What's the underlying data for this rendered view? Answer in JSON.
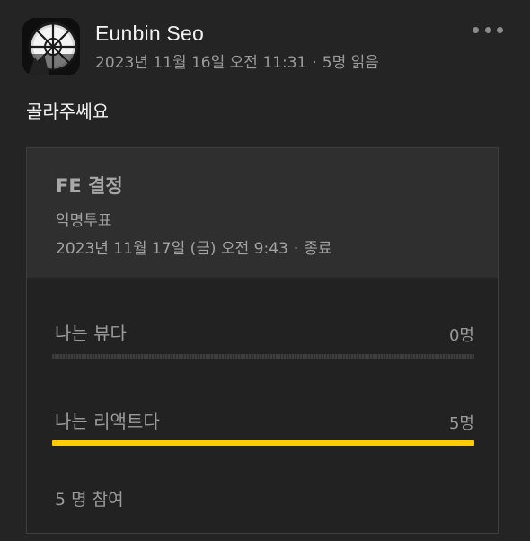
{
  "post": {
    "author": "Eunbin Seo",
    "date": "2023년 11월 16일 오전 11:31",
    "separator": "·",
    "read_count": "5명 읽음",
    "more_icon": "more-horizontal-icon",
    "content": "골라주쎄요"
  },
  "poll": {
    "title": "FE 결정",
    "type": "익명투표",
    "end_date": "2023년 11월 17일 (금) 오전 9:43",
    "separator": "·",
    "status": "종료",
    "options": [
      {
        "label": "나는 뷰다",
        "count": "0명",
        "votes": 0,
        "share": 0.0
      },
      {
        "label": "나는 리액트다",
        "count": "5명",
        "votes": 5,
        "share": 1.0
      }
    ],
    "participants": "5 명 참여",
    "accent_color": "#ffcc00"
  }
}
